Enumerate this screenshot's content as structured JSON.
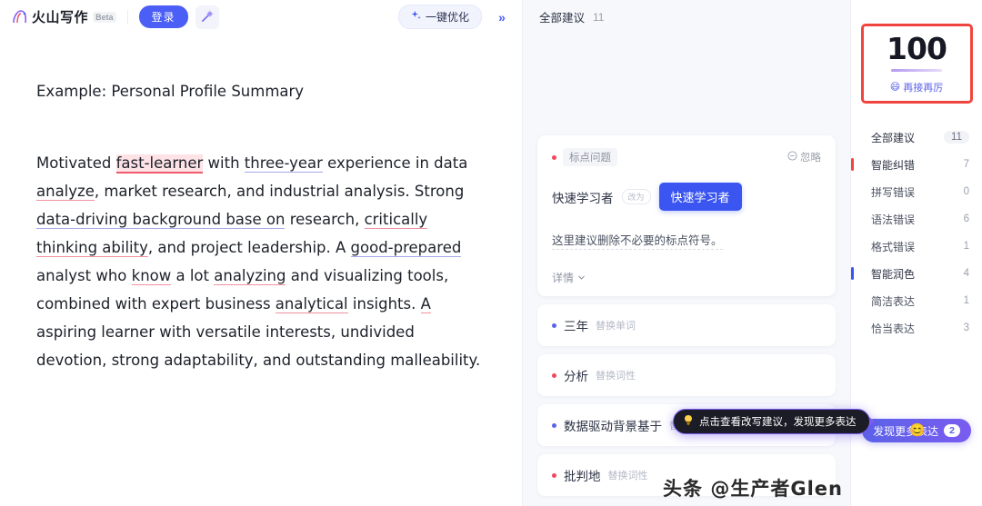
{
  "header": {
    "brand_name": "火山写作",
    "beta_label": "Beta",
    "login_label": "登录",
    "wand_icon": "magic-wand-icon",
    "optimize_label": "一键优化",
    "optimize_icon": "sparkle-icon",
    "collapse_icon": "chevron-double-right-icon"
  },
  "document": {
    "title": "Example: Personal Profile Summary",
    "paragraph": {
      "s1": "Motivated ",
      "w_fast_learner": "fast-learner",
      "s2": " with ",
      "w_three_year": "three-year",
      "s3": " experience in data ",
      "w_analyze": "analyze",
      "s4": ", market research, and industrial analysis. Strong ",
      "w_data_driving": "data-driving background base on",
      "s5": " research, ",
      "w_critically": "critically thinking ability",
      "s6": ", and project leadership. A ",
      "w_good_prepared": "good-prepared",
      "s7": " analyst who ",
      "w_know": "know",
      "s8": " a lot ",
      "w_analyzing": "analyzing",
      "s9": " and visualizing tools, combined with expert business ",
      "w_analytical": "analytical",
      "s10": " insights. ",
      "w_a": "A",
      "s11": " aspiring learner with versatile interests, undivided devotion, strong adaptability, and outstanding malleability."
    }
  },
  "suggestions_panel": {
    "header_title": "全部建议",
    "header_count": "11",
    "card": {
      "dot_color": "#f0485f",
      "tag": "标点问题",
      "ignore_label": "忽略",
      "ignore_icon": "minus-circle-icon",
      "original_word": "快速学习者",
      "arrow_chip": "改为",
      "replacement_word": "快速学习者",
      "description": "这里建议删除不必要的标点符号。",
      "more_label": "详情",
      "more_icon": "chevron-down-icon"
    },
    "items": [
      {
        "word": "三年",
        "action": "替换单词",
        "dot_color": "#5b63e8"
      },
      {
        "word": "分析",
        "action": "替换词性",
        "dot_color": "#f0485f"
      },
      {
        "word": "数据驱动背景基于",
        "action": "替换单词",
        "dot_color": "#5b63e8"
      },
      {
        "word": "批判地",
        "action": "替换词性",
        "dot_color": "#f0485f"
      }
    ],
    "tooltip": {
      "icon": "lightbulb-icon",
      "text": "点击查看改写建议，发现更多表达"
    }
  },
  "sidebar": {
    "score": "100",
    "score_sub": "再接再厉",
    "score_emoji": "😄",
    "score_border_color": "#f0453f",
    "nav": [
      {
        "label": "全部建议",
        "count": "11",
        "marker": "none",
        "group": true,
        "pill": true
      },
      {
        "label": "智能纠错",
        "count": "7",
        "marker": "red",
        "group": true,
        "pill": false
      },
      {
        "label": "拼写错误",
        "count": "0",
        "marker": "none",
        "group": false,
        "pill": false
      },
      {
        "label": "语法错误",
        "count": "6",
        "marker": "none",
        "group": false,
        "pill": false
      },
      {
        "label": "格式错误",
        "count": "1",
        "marker": "none",
        "group": false,
        "pill": false
      },
      {
        "label": "智能润色",
        "count": "4",
        "marker": "blue",
        "group": true,
        "pill": false
      },
      {
        "label": "简洁表达",
        "count": "1",
        "marker": "none",
        "group": false,
        "pill": false
      },
      {
        "label": "恰当表达",
        "count": "3",
        "marker": "none",
        "group": false,
        "pill": false
      }
    ],
    "discover_label": "发现更多表达",
    "discover_count": "2",
    "discover_emoji": "😊"
  },
  "watermark": "头条 @生产者Glen"
}
